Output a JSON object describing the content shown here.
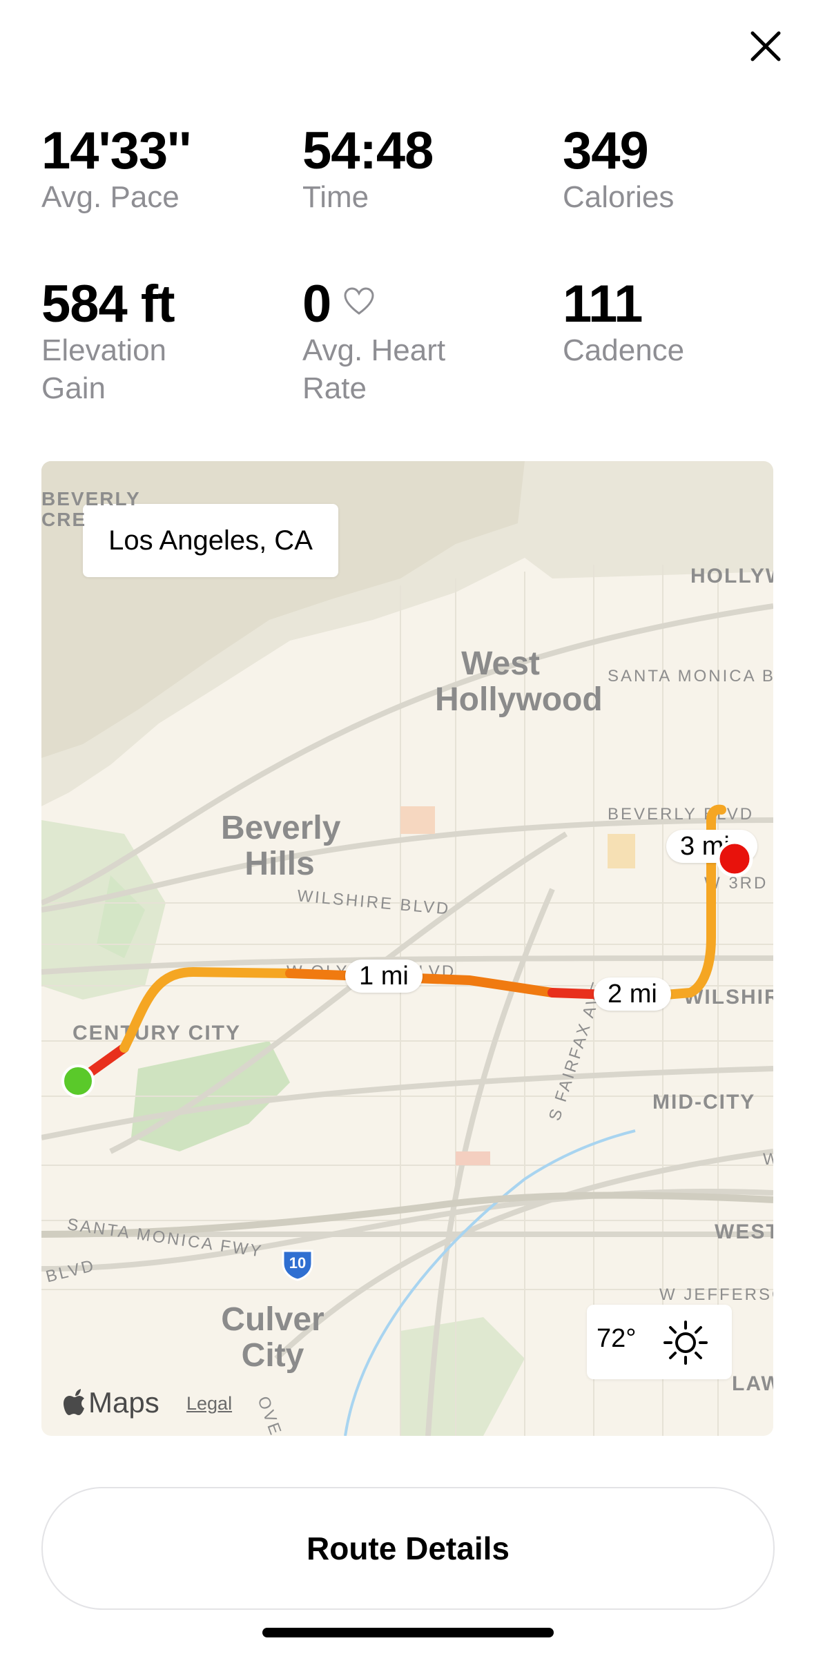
{
  "close_icon": "close-icon",
  "stats": [
    {
      "value": "14'33''",
      "label": "Avg. Pace"
    },
    {
      "value": "54:48",
      "label": "Time"
    },
    {
      "value": "349",
      "label": "Calories"
    },
    {
      "value": "584 ft",
      "label": "Elevation Gain"
    },
    {
      "value": "0",
      "label": "Avg. Heart Rate",
      "icon": "heart-icon"
    },
    {
      "value": "111",
      "label": "Cadence"
    }
  ],
  "map": {
    "location": "Los Angeles, CA",
    "places": {
      "west_hollywood": "West Hollywood",
      "beverly_hills": "Beverly Hills",
      "culver_city": "Culver City",
      "century_city": "CENTURY CITY",
      "mid_city": "MID-CITY",
      "west": "WEST",
      "hollywood": "HOLLYWO",
      "beverly_crest": "BEVERLY CRE"
    },
    "streets": {
      "santa_monica_bl": "SANTA MONICA BL",
      "beverly_blvd": "BEVERLY BLVD",
      "w_3rd": "W 3RD",
      "wilshire_blvd": "WILSHIRE BLVD",
      "wilshire": "WILSHIRE",
      "w_olympic": "W OLYMPIC BLVD",
      "fairfax": "S FAIRFAX AVE",
      "santa_monica_fwy": "SANTA MONICA FWY",
      "blvd": "BLVD",
      "w_jefferson": "W JEFFERSO",
      "law": "LAW",
      "ove": "OVE",
      "w_edge": "W"
    },
    "highway_shield": "10",
    "mile_markers": [
      "1 mi",
      "2 mi",
      "3 mi"
    ],
    "weather": {
      "temp": "72°",
      "icon": "sun-icon"
    },
    "maps_brand": "Maps",
    "legal": "Legal",
    "route_colors": {
      "fast": "#f5a623",
      "mid": "#f07a10",
      "slow": "#e8301c"
    },
    "start_color": "#5ac92a",
    "end_color": "#e8120c"
  },
  "route_button": "Route Details"
}
